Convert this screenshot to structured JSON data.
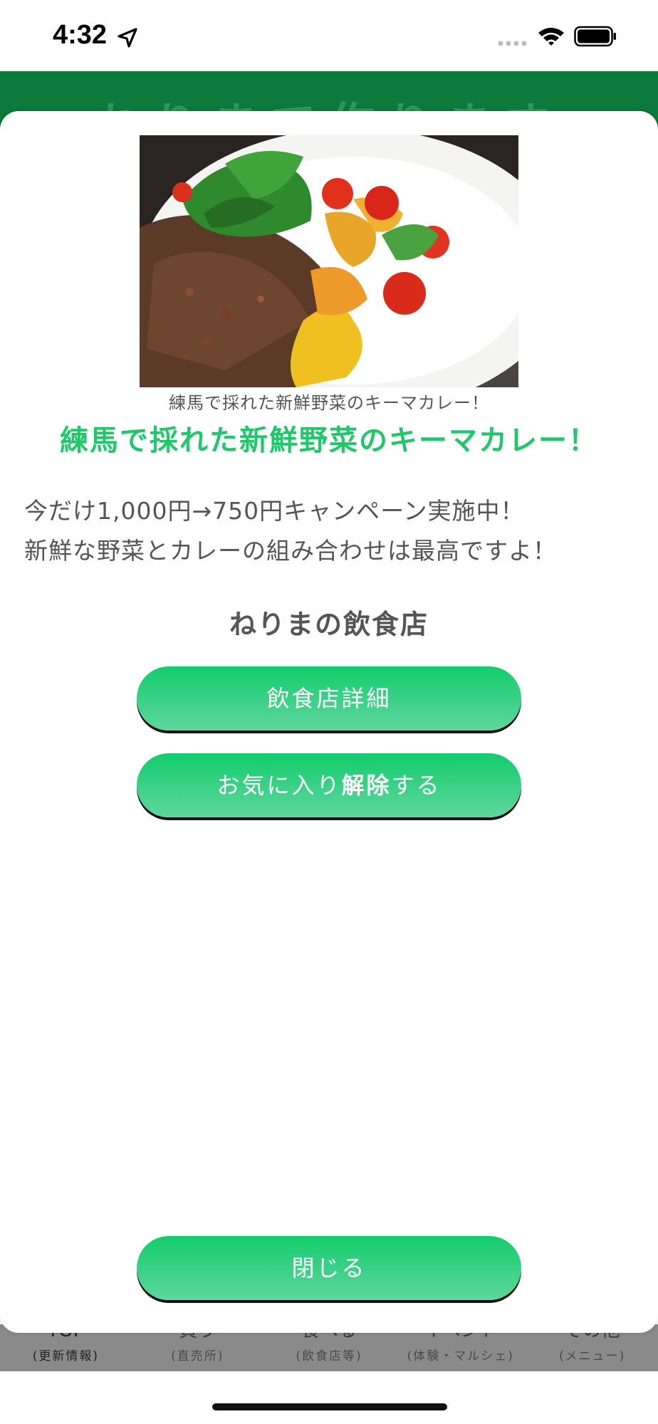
{
  "status_bar": {
    "time": "4:32"
  },
  "app_header": {
    "title": "ねりまで作ります"
  },
  "modal": {
    "photo_icon": "keema-curry-photo",
    "caption": "練馬で採れた新鮮野菜のキーマカレー！",
    "headline": "練馬で採れた新鮮野菜のキーマカレー！",
    "description_lines": [
      "今だけ1,000円→750円キャンペーン実施中！",
      "新鮮な野菜とカレーの組み合わせは最高ですよ！"
    ],
    "shop_name": "ねりまの飲食店",
    "detail_button": "飲食店詳細",
    "favorite_button": {
      "prefix": "お気に入り",
      "emphasis": "解除",
      "suffix": "する"
    },
    "close_button": "閉じる"
  },
  "tab_bar": {
    "items": [
      {
        "label": "TOP",
        "sub": "(更新情報)"
      },
      {
        "label": "買う",
        "sub": "(直売所)"
      },
      {
        "label": "食べる",
        "sub": "(飲食店等)"
      },
      {
        "label": "イベント",
        "sub": "(体験・マルシェ)"
      },
      {
        "label": "その他",
        "sub": "(メニュー)"
      }
    ]
  },
  "colors": {
    "accent_green": "#1fc86a",
    "header_green": "#0b7a3a",
    "button_top": "#13cc6c",
    "button_bottom": "#5fd69e"
  }
}
